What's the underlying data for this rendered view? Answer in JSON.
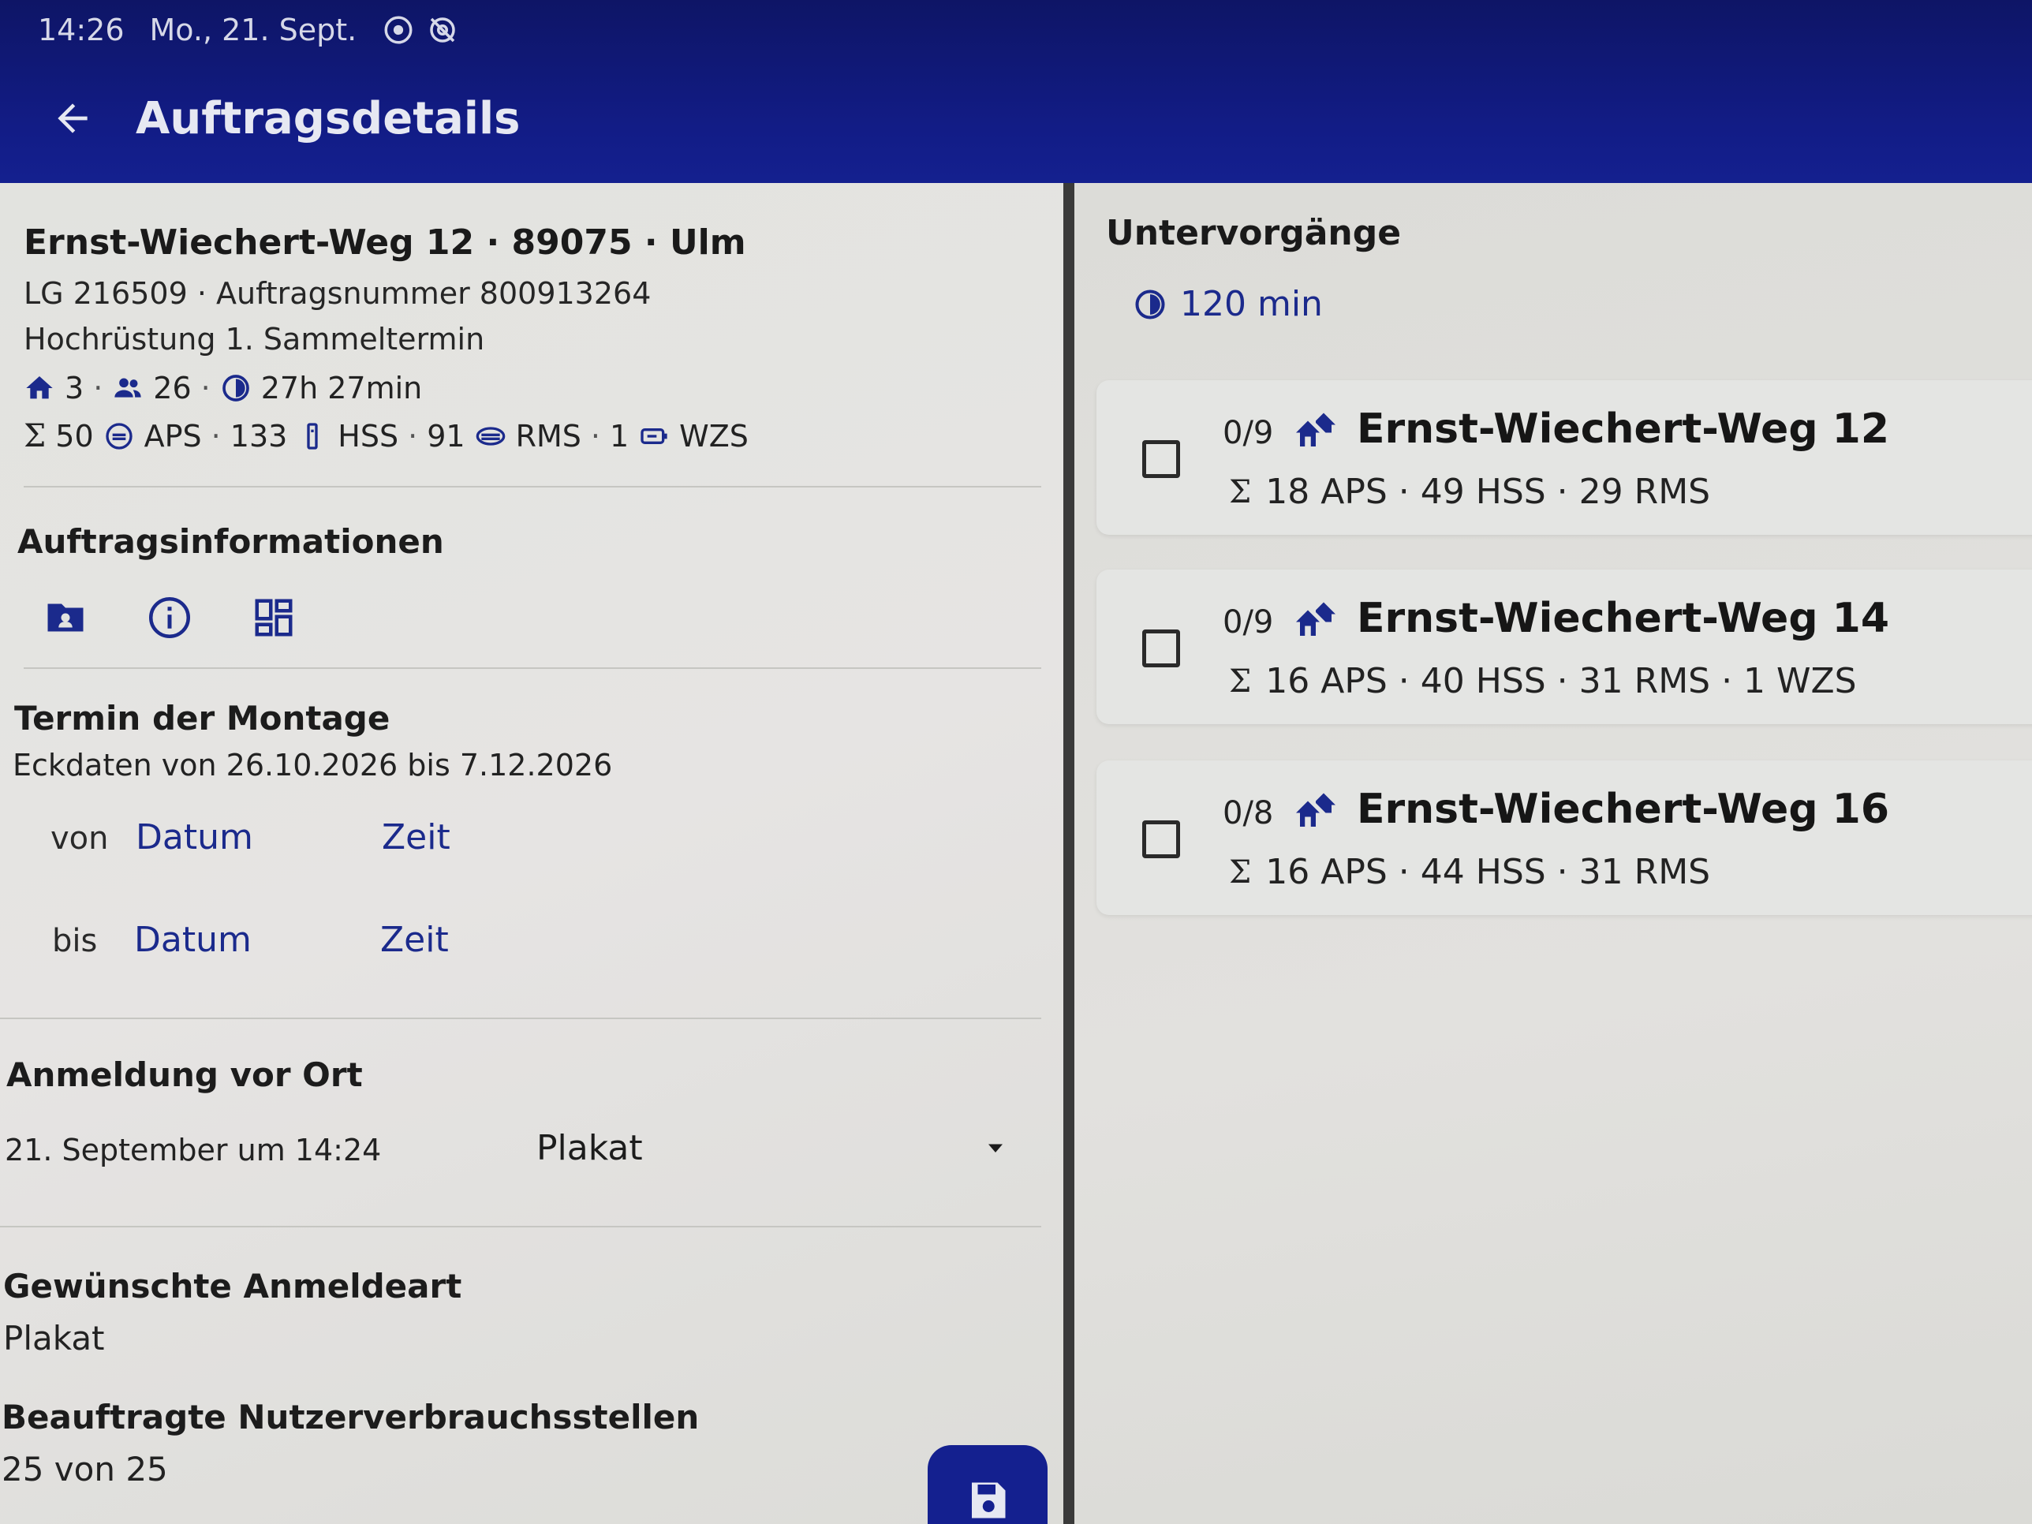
{
  "status_bar": {
    "time": "14:26",
    "date": "Mo., 21. Sept."
  },
  "app_bar": {
    "title": "Auftragsdetails"
  },
  "order": {
    "address": "Ernst-Wiechert-Weg 12 · 89075 · Ulm",
    "ids": "LG 216509 · Auftragsnummer 800913264",
    "type": "Hochrüstung 1. Sammeltermin",
    "buildings": "3",
    "persons": "26",
    "duration": "27h 27min",
    "aps_count": "50",
    "aps_label": "APS",
    "hss_count": "133",
    "hss_label": "HSS",
    "rms_count": "91",
    "rms_label": "RMS",
    "wzs_count": "1",
    "wzs_label": "WZS"
  },
  "auftragsinformationen": {
    "title": "Auftragsinformationen",
    "icons": [
      "folder-account-icon",
      "info-icon",
      "dashboard-icon"
    ]
  },
  "termin": {
    "title": "Termin der Montage",
    "eckdaten": "Eckdaten von 26.10.2026 bis 7.12.2026",
    "from_label": "von",
    "to_label": "bis",
    "date_link": "Datum",
    "time_link": "Zeit"
  },
  "anmeldung": {
    "title": "Anmeldung vor Ort",
    "timestamp": "21. September um 14:24",
    "method": "Plakat"
  },
  "gewuenschte": {
    "title": "Gewünschte Anmeldeart",
    "value": "Plakat"
  },
  "beauftragte": {
    "title": "Beauftragte Nutzerverbrauchsstellen",
    "value": "25 von 25"
  },
  "untervorgaenge": {
    "title": "Untervorgänge",
    "duration": "120 min",
    "items": [
      {
        "progress": "0/9",
        "address": "Ernst-Wiechert-Weg 12",
        "summary": "18 APS · 49 HSS · 29 RMS"
      },
      {
        "progress": "0/9",
        "address": "Ernst-Wiechert-Weg 14",
        "summary": "16 APS · 40 HSS · 31 RMS · 1 WZS"
      },
      {
        "progress": "0/8",
        "address": "Ernst-Wiechert-Weg 16",
        "summary": "16 APS · 44 HSS · 31 RMS"
      }
    ]
  },
  "sigma": "Σ",
  "colors": {
    "appbar": "#121c86",
    "accent": "#1b2a8c"
  }
}
